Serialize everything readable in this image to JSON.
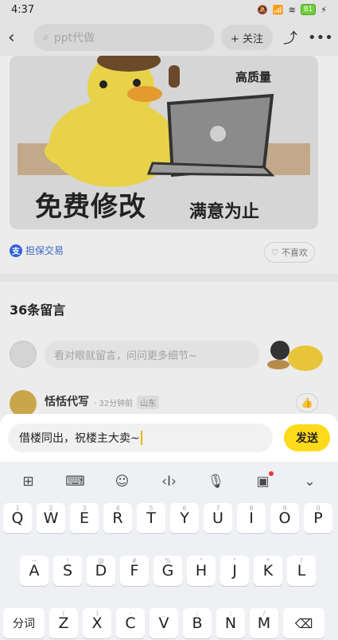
{
  "status": {
    "time": "4:37",
    "battery": "81"
  },
  "nav": {
    "back_icon": "chevron-left-icon",
    "search_placeholder": "ppt代做",
    "follow_label": "+ 关注"
  },
  "product": {
    "text_free": "免费修改",
    "text_satisfied": "满意为止",
    "text_quality": "高质量"
  },
  "guarantee": {
    "label": "担保交易",
    "dislike_label": "不喜欢"
  },
  "comments": {
    "title": "36条留言",
    "input_placeholder": "看对眼就留言，问问更多细节~",
    "first": {
      "name": "恬恬代写",
      "time": "· 32分钟前",
      "location": "山东"
    }
  },
  "reply": {
    "text": "借楼同出，祝楼主大卖~",
    "send_label": "发送"
  },
  "keyboard": {
    "row1": [
      {
        "key": "Q",
        "alt": "1"
      },
      {
        "key": "W",
        "alt": "2"
      },
      {
        "key": "E",
        "alt": "3"
      },
      {
        "key": "R",
        "alt": "4"
      },
      {
        "key": "T",
        "alt": "5"
      },
      {
        "key": "Y",
        "alt": "6"
      },
      {
        "key": "U",
        "alt": "7"
      },
      {
        "key": "I",
        "alt": "8"
      },
      {
        "key": "O",
        "alt": "9"
      },
      {
        "key": "P",
        "alt": "0"
      }
    ],
    "row2": [
      {
        "key": "A",
        "alt": "~"
      },
      {
        "key": "S",
        "alt": "!"
      },
      {
        "key": "D",
        "alt": "@"
      },
      {
        "key": "F",
        "alt": "#"
      },
      {
        "key": "G",
        "alt": "%"
      },
      {
        "key": "H",
        "alt": "\""
      },
      {
        "key": "J",
        "alt": "\""
      },
      {
        "key": "K",
        "alt": "*"
      },
      {
        "key": "L",
        "alt": "?"
      }
    ],
    "row3": [
      {
        "key": "Z",
        "alt": "("
      },
      {
        "key": "X",
        "alt": ")"
      },
      {
        "key": "C",
        "alt": "-"
      },
      {
        "key": "V",
        "alt": "_"
      },
      {
        "key": "B",
        "alt": ":"
      },
      {
        "key": "N",
        "alt": ";"
      },
      {
        "key": "M",
        "alt": "/"
      }
    ],
    "fn_label": "分词"
  }
}
